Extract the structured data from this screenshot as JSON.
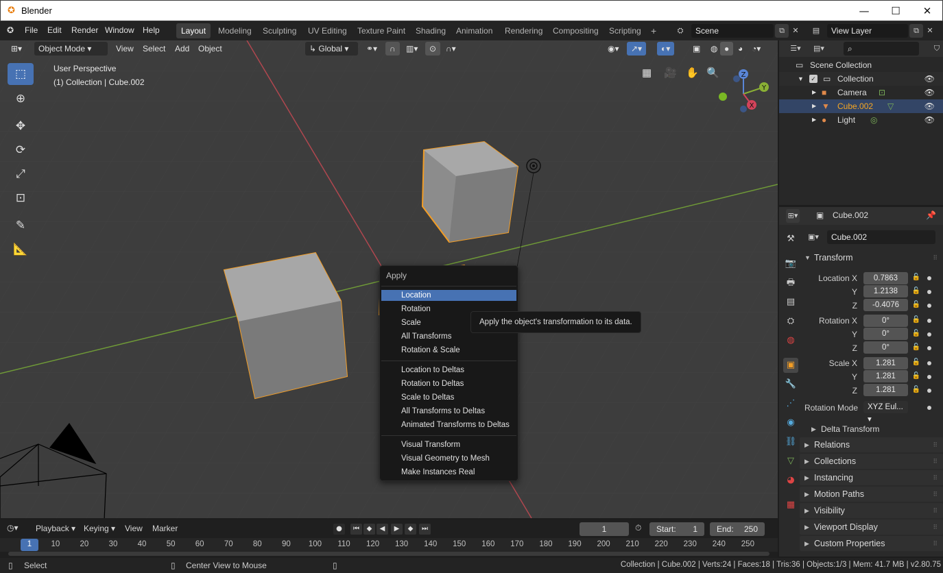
{
  "window": {
    "title": "Blender",
    "minimize": "—",
    "maximize": "☐",
    "close": "✕"
  },
  "topmenu": [
    "File",
    "Edit",
    "Render",
    "Window",
    "Help"
  ],
  "workspaces": [
    "Layout",
    "Modeling",
    "Sculpting",
    "UV Editing",
    "Texture Paint",
    "Shading",
    "Animation",
    "Rendering",
    "Compositing",
    "Scripting"
  ],
  "scene": {
    "name": "Scene",
    "view_layer": "View Layer"
  },
  "viewport": {
    "mode": "Object Mode",
    "menus": [
      "View",
      "Select",
      "Add",
      "Object"
    ],
    "transform_orientation": "Global",
    "info_line1": "User Perspective",
    "info_line2": "(1) Collection | Cube.002",
    "gizmo": {
      "x": "X",
      "y": "Y",
      "z": "Z"
    }
  },
  "context_menu": {
    "title": "Apply",
    "items": [
      "Location",
      "Rotation",
      "Scale",
      "All Transforms",
      "Rotation & Scale",
      "Location to Deltas",
      "Rotation to Deltas",
      "Scale to Deltas",
      "All Transforms to Deltas",
      "Animated Transforms to Deltas",
      "Visual Transform",
      "Visual Geometry to Mesh",
      "Make Instances Real"
    ],
    "highlighted": "Location"
  },
  "tooltip": "Apply the object's transformation to its data.",
  "outliner": {
    "scene_collection": "Scene Collection",
    "collection": "Collection",
    "items": [
      "Camera",
      "Cube.002",
      "Light"
    ]
  },
  "properties": {
    "object_name": "Cube.002",
    "data_name": "Cube.002",
    "transform_header": "Transform",
    "location": {
      "label": "Location X",
      "x": "0.7863",
      "y": "1.2138",
      "z": "-0.4076"
    },
    "rotation": {
      "label": "Rotation X",
      "x": "0°",
      "y": "0°",
      "z": "0°"
    },
    "scale": {
      "label": "Scale X",
      "x": "1.281",
      "y": "1.281",
      "z": "1.281"
    },
    "axis_y": "Y",
    "axis_z": "Z",
    "rotation_mode_label": "Rotation Mode",
    "rotation_mode": "XYZ Eul...",
    "delta_transform": "Delta Transform",
    "sections": [
      "Relations",
      "Collections",
      "Instancing",
      "Motion Paths",
      "Visibility",
      "Viewport Display",
      "Custom Properties"
    ]
  },
  "timeline": {
    "menus": [
      "Playback",
      "Keying",
      "View",
      "Marker"
    ],
    "current_frame": "1",
    "start_label": "Start:",
    "start": "1",
    "end_label": "End:",
    "end": "250",
    "ruler": [
      "1",
      "10",
      "20",
      "30",
      "40",
      "50",
      "60",
      "70",
      "80",
      "90",
      "100",
      "110",
      "120",
      "130",
      "140",
      "150",
      "160",
      "170",
      "180",
      "190",
      "200",
      "210",
      "220",
      "230",
      "240",
      "250"
    ]
  },
  "statusbar": {
    "select": "Select",
    "center_view": "Center View to Mouse",
    "stats": "Collection | Cube.002 | Verts:24 | Faces:18 | Tris:36 | Objects:1/3 | Mem: 41.7 MB | v2.80.75"
  },
  "colors": {
    "accent": "#4772b3",
    "selection_outline": "#f29d26",
    "active_object_text": "#f5a623"
  }
}
